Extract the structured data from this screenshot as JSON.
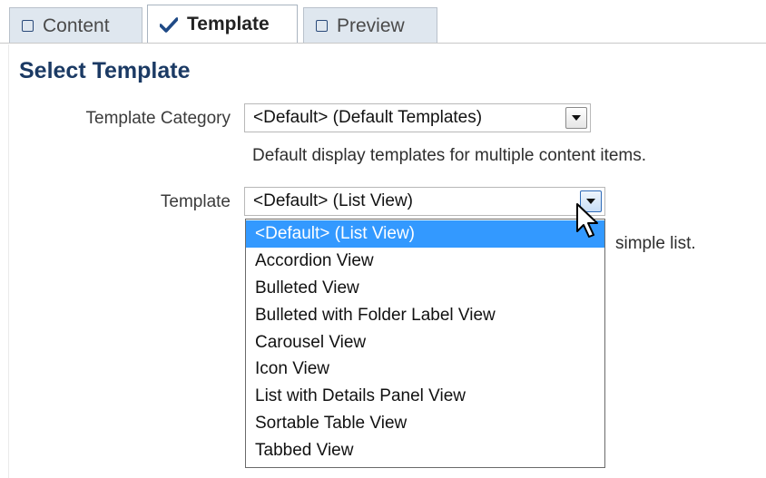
{
  "tabs": [
    {
      "label": "Content",
      "icon": "checkbox-empty-icon",
      "active": false
    },
    {
      "label": "Template",
      "icon": "checkmark-icon",
      "active": true
    },
    {
      "label": "Preview",
      "icon": "checkbox-empty-icon",
      "active": false
    }
  ],
  "section": {
    "title": "Select Template"
  },
  "category": {
    "label": "Template Category",
    "selected": "<Default> (Default Templates)",
    "description": "Default display templates for multiple content items."
  },
  "template": {
    "label": "Template",
    "selected": "<Default> (List View)",
    "description_tail": "simple list.",
    "options": [
      "<Default> (List View)",
      "Accordion View",
      "Bulleted View",
      "Bulleted with Folder Label View",
      "Carousel View",
      "Icon View",
      "List with Details Panel View",
      "Sortable Table View",
      "Tabbed View"
    ],
    "highlighted_index": 0
  },
  "colors": {
    "title": "#1b3a64",
    "highlight": "#3399ff",
    "tab_inactive_bg": "#dfe7ef"
  }
}
